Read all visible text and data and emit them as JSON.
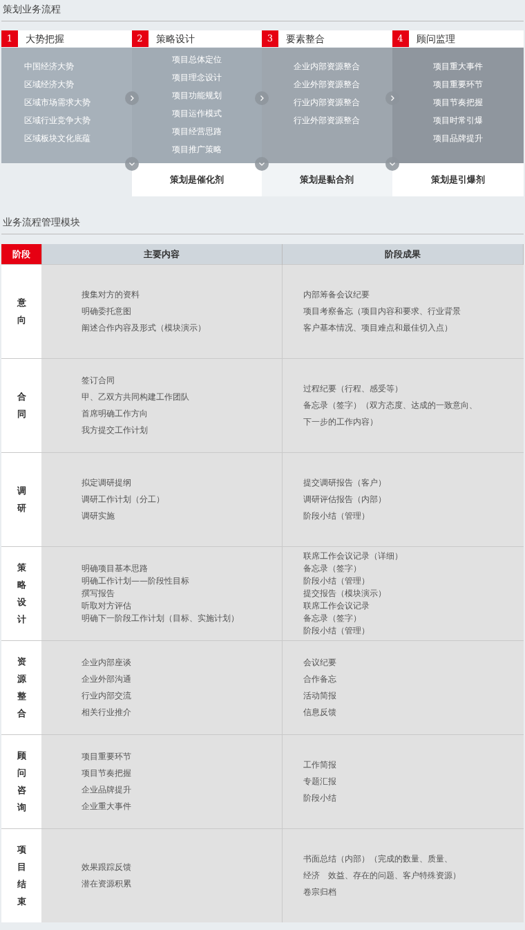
{
  "flow": {
    "title": "策划业务流程",
    "phases": [
      {
        "number": "1",
        "title": "大势把握",
        "items": [
          "中国经济大势",
          "区域经济大势",
          "区域市场需求大势",
          "区域行业竞争大势",
          "区域板块文化底蕴"
        ]
      },
      {
        "number": "2",
        "title": "策略设计",
        "items": [
          "项目总体定位",
          "项目理念设计",
          "项目功能规划",
          "项目运作模式",
          "项目经营思路",
          "项目推广策略"
        ],
        "tagline": "策划是催化剂"
      },
      {
        "number": "3",
        "title": "要素整合",
        "items": [
          "企业内部资源整合",
          "企业外部资源整合",
          "行业内部资源整合",
          "行业外部资源整合"
        ],
        "tagline": "策划是黏合剂"
      },
      {
        "number": "4",
        "title": "顾问监理",
        "items": [
          "项目重大事件",
          "项目重要环节",
          "项目节奏把握",
          "项目时常引爆",
          "项目品牌提升"
        ],
        "tagline": "策划是引爆剂"
      }
    ]
  },
  "modules": {
    "title": "业务流程管理模块",
    "table": {
      "columns": [
        "阶段",
        "主要内容",
        "阶段成果"
      ],
      "rows": [
        {
          "stage": "意向",
          "content": [
            "搜集对方的资料",
            "明确委托意图",
            "阐述合作内容及形式（模块演示）"
          ],
          "results": [
            "内部筹备会议纪要",
            "项目考察备忘（项目内容和要求、行业背景",
            "客户基本情况、项目难点和最佳切入点）"
          ]
        },
        {
          "stage": "合同",
          "content": [
            "签订合同",
            "甲、乙双方共同构建工作团队",
            "首席明确工作方向",
            "我方提交工作计划"
          ],
          "results": [
            "过程纪要（行程、感受等）",
            "备忘录（签字）（双方态度、达成的一致意向、",
            "下一步的工作内容）"
          ]
        },
        {
          "stage": "调研",
          "content": [
            "拟定调研提纲",
            "调研工作计划（分工）",
            "调研实施"
          ],
          "results": [
            "提交调研报告（客户）",
            "调研评估报告（内部）",
            "阶段小结（管理）"
          ]
        },
        {
          "stage": "策略设计",
          "content": [
            "明确项目基本思路",
            "明确工作计划——阶段性目标",
            "撰写报告",
            "听取对方评估",
            "明确下一阶段工作计划（目标、实施计划）"
          ],
          "results": [
            "联席工作会议记录（详细）",
            "备忘录（签字）",
            "阶段小结（管理）",
            "提交报告（模块演示）",
            "联席工作会议记录",
            "备忘录（签字）",
            "阶段小结（管理）"
          ]
        },
        {
          "stage": "资源整合",
          "content": [
            "企业内部座谈",
            "企业外部沟通",
            "行业内部交流",
            "相关行业推介"
          ],
          "results": [
            "会议纪要",
            "合作备忘",
            "活动简报",
            "信息反馈"
          ]
        },
        {
          "stage": "顾问咨询",
          "content": [
            "项目重要环节",
            "项目节奏把握",
            "企业品牌提升",
            "企业重大事件"
          ],
          "results": [
            "工作简报",
            "专题汇报",
            "阶段小结"
          ]
        },
        {
          "stage": "项目结束",
          "content": [
            "效果跟踪反馈",
            "潜在资源积累"
          ],
          "results": [
            "书面总结（内部）（完成的数量、质量、",
            "经济　效益、存在的问题、客户特殊资源）",
            "卷宗归档"
          ]
        }
      ]
    }
  }
}
